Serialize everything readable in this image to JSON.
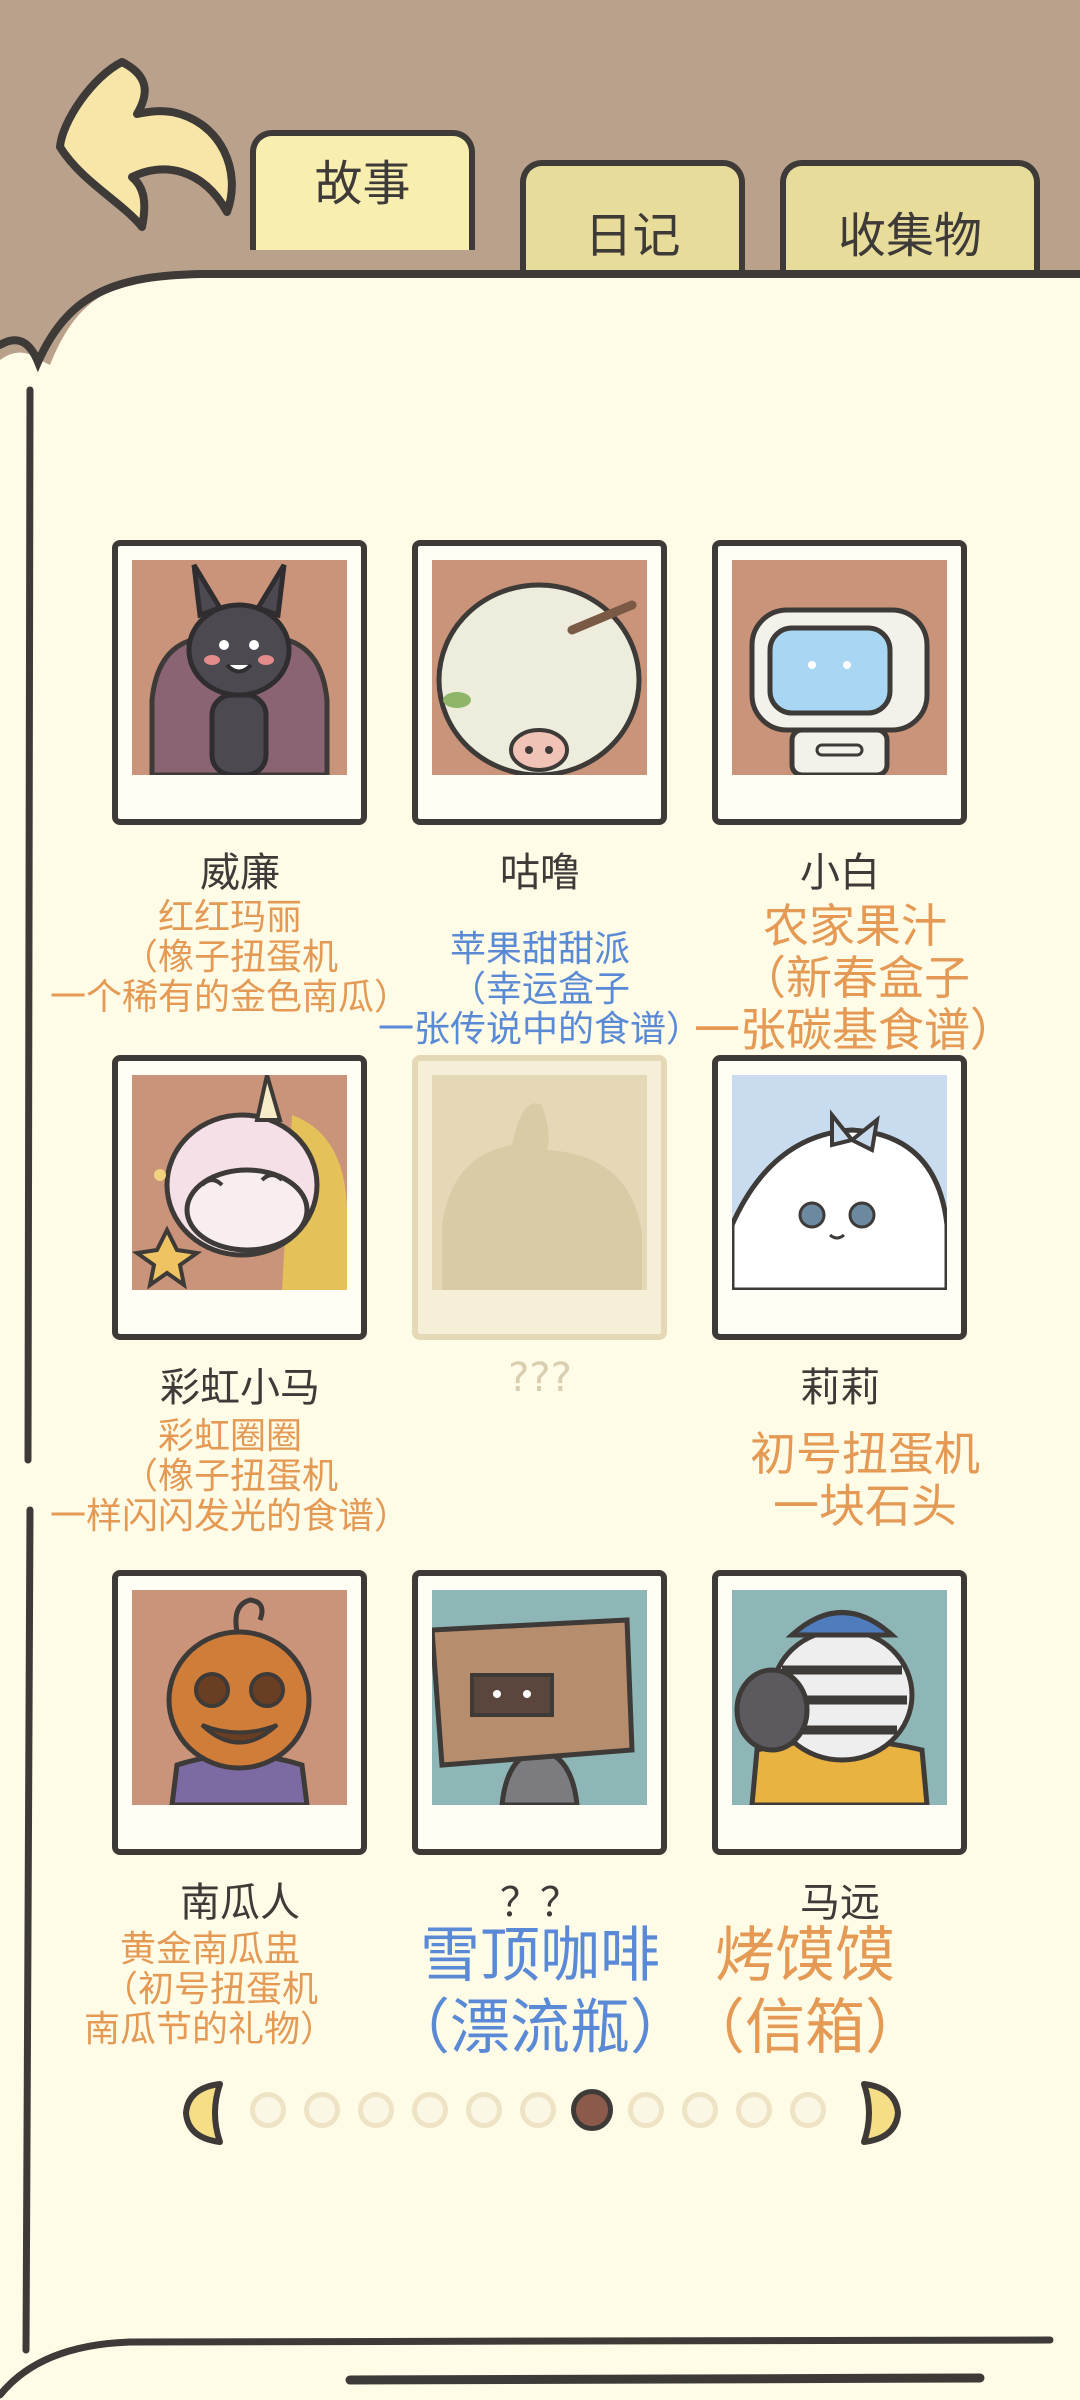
{
  "tabs": [
    {
      "label": "故事",
      "active": true
    },
    {
      "label": "日记",
      "active": false
    },
    {
      "label": "收集物",
      "active": false
    }
  ],
  "characters": [
    {
      "name": "威廉",
      "note_lines": [
        "红红玛丽",
        "（橡子扭蛋机",
        "一个稀有的金色南瓜）"
      ],
      "note_color": "orange"
    },
    {
      "name": "咕噜",
      "note_lines": [
        "苹果甜甜派",
        "（幸运盒子",
        "一张传说中的食谱）"
      ],
      "note_color": "blue"
    },
    {
      "name": "小白",
      "note_lines": [
        "农家果汁",
        "（新春盒子",
        "一张碳基食谱）"
      ],
      "note_color": "orange"
    },
    {
      "name": "彩虹小马",
      "note_lines": [
        "彩虹圈圈",
        "（橡子扭蛋机",
        "一样闪闪发光的食谱）"
      ],
      "note_color": "orange"
    },
    {
      "name": "???",
      "locked": true,
      "note_lines": []
    },
    {
      "name": "莉莉",
      "note_lines": [
        "初号扭蛋机",
        "一块石头"
      ],
      "note_color": "orange"
    },
    {
      "name": "南瓜人",
      "note_lines": [
        "黄金南瓜盅",
        "（初号扭蛋机",
        "南瓜节的礼物）"
      ],
      "note_color": "orange"
    },
    {
      "name": "？？",
      "note_lines": [
        "雪顶咖啡",
        "（漂流瓶）"
      ],
      "note_color": "blue"
    },
    {
      "name": "马远",
      "note_lines": [
        "烤馍馍",
        "（信箱）"
      ],
      "note_color": "orange"
    }
  ],
  "pager": {
    "total": 11,
    "current": 7
  },
  "colors": {
    "orange": "#e49a54",
    "blue": "#5a8ad6",
    "paper": "#fefbe6",
    "frame": "#b9a18b"
  }
}
